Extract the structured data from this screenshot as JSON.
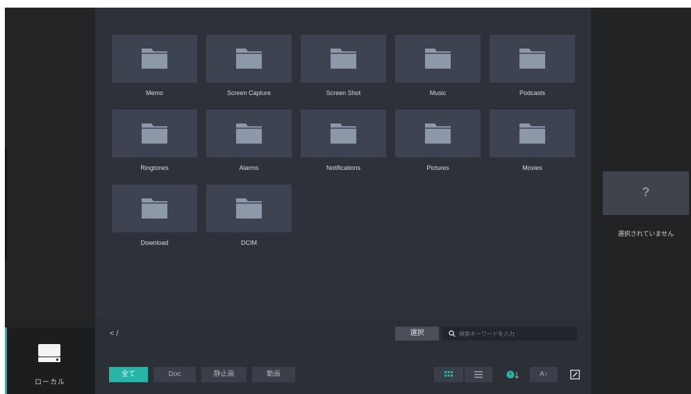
{
  "sidebar": {
    "local_label": "ローカル"
  },
  "folders": [
    {
      "name": "Memo"
    },
    {
      "name": "Screen Capture"
    },
    {
      "name": "Screen Shot"
    },
    {
      "name": "Music"
    },
    {
      "name": "Podcasts"
    },
    {
      "name": "Ringtones"
    },
    {
      "name": "Alarms"
    },
    {
      "name": "Notifications"
    },
    {
      "name": "Pictures"
    },
    {
      "name": "Movies"
    },
    {
      "name": "Download"
    },
    {
      "name": "DCIM"
    }
  ],
  "toolbar": {
    "path": "< /",
    "select_label": "選択",
    "search_placeholder": "検索キーワードを入力"
  },
  "filter_tabs": [
    {
      "label": "全て",
      "active": true
    },
    {
      "label": "Doc",
      "active": false
    },
    {
      "label": "静止画",
      "active": false
    },
    {
      "label": "動画",
      "active": false
    }
  ],
  "sort": {
    "name_label": "A↑"
  },
  "preview": {
    "placeholder_glyph": "?",
    "empty_label": "選択されていません"
  },
  "colors": {
    "accent": "#27b5a7",
    "tile": "#3d4350",
    "folder_icon": "#8d99a8",
    "background": "#2d3139"
  }
}
